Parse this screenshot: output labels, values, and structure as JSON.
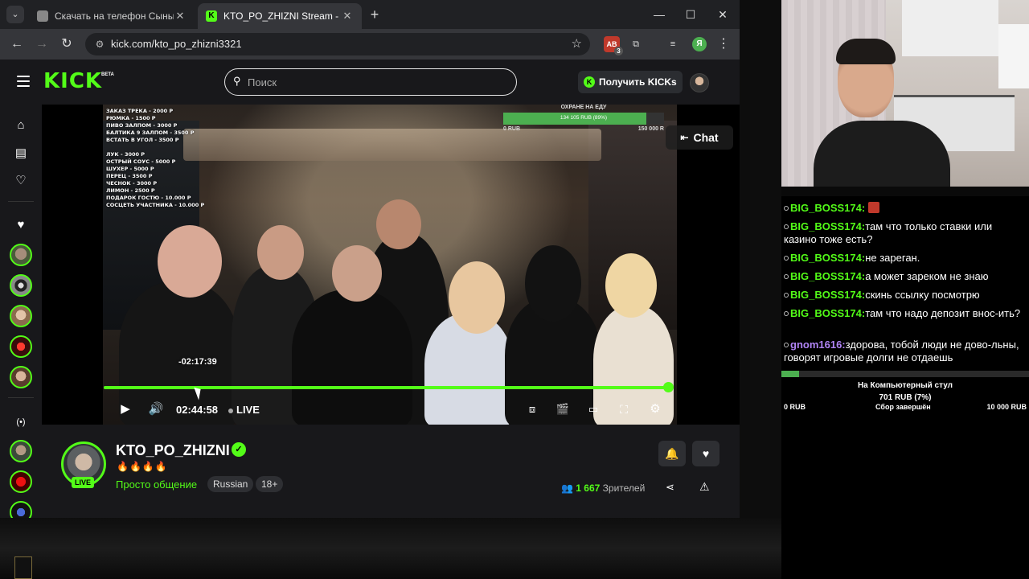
{
  "browser": {
    "tabs": [
      {
        "title": "Скачать на телефон Сыны ан",
        "active": false
      },
      {
        "title": "KTO_PO_ZHIZNI Stream - Watc",
        "active": true
      }
    ],
    "url": "kick.com/kto_po_zhizni3321",
    "extension_badge": "3",
    "profile_letter": "Я"
  },
  "header": {
    "logo": "KICK",
    "logo_beta": "BETA",
    "search_placeholder": "Поиск",
    "get_kicks_label": "Получить KICKs"
  },
  "overlay": {
    "price_list": [
      "ЗАКАЗ ТРЕКА - 2000 Р",
      "РЮМКА - 1500 Р",
      "ПИВО ЗАЛПОМ - 3000 Р",
      "БАЛТИКА 9 ЗАЛПОМ - 3500 Р",
      "ВСТАТЬ В УГОЛ - 3500 Р",
      "",
      "ЛУК - 3000 Р",
      "ОСТРЫЙ СОУС - 5000 Р",
      "ШУХЕР - 5000 Р",
      "ПЕРЕЦ - 3500 Р",
      "ЧЕСНОК - 3000 Р",
      "ЛИМОН - 2500 Р",
      "ПОДАРОК ГОСТЮ - 10.000 Р",
      "СОСЦЕТЬ УЧАСТНИКА - 10.000 Р"
    ],
    "goal": {
      "title": "ОХРАНЕ НА ЕДУ",
      "progress_text": "134 105 RUB (89%)",
      "progress": 0.89,
      "min": "0 RUB",
      "max": "150 000 R"
    },
    "chat_button": "Chat"
  },
  "player": {
    "seek_tooltip": "-02:17:39",
    "progress": 0.995,
    "elapsed": "02:44:58",
    "live_label": "LIVE"
  },
  "channel": {
    "name": "KTO_PO_ZHIZNI",
    "live_badge": "LIVE",
    "emojis": "🔥🔥🔥🔥",
    "category": "Просто общение",
    "tags": [
      "Russian",
      "18+"
    ],
    "viewers_count": "1 667",
    "viewers_label": "Зрителей"
  },
  "chat": {
    "messages": [
      {
        "user": "BIG_BOSS174:",
        "text": "",
        "color": "#53fc18",
        "emote": true
      },
      {
        "user": "BIG_BOSS174:",
        "text": "там что только ставки или казино тоже есть?",
        "color": "#53fc18"
      },
      {
        "user": "BIG_BOSS174:",
        "text": "не зареган.",
        "color": "#53fc18"
      },
      {
        "user": "BIG_BOSS174:",
        "text": "а может зареком не знаю",
        "color": "#53fc18"
      },
      {
        "user": "BIG_BOSS174:",
        "text": "скинь ссылку посмотрю",
        "color": "#53fc18"
      },
      {
        "user": "BIG_BOSS174:",
        "text": "там что надо депозит внос-ить?",
        "color": "#53fc18"
      },
      {
        "user": "gnom1616:",
        "text": "здорова, тобой люди не дово-льны, говорят игровые долги не отдаешь",
        "color": "#b084f5"
      }
    ],
    "goal": {
      "title": "На Компьютерный стул",
      "amount": "701 RUB (7%)",
      "progress": 0.07,
      "min": "0 RUB",
      "status": "Сбор завершён",
      "max": "10 000 RUB"
    }
  },
  "colors": {
    "accent": "#53fc18",
    "background": "#18181b"
  }
}
